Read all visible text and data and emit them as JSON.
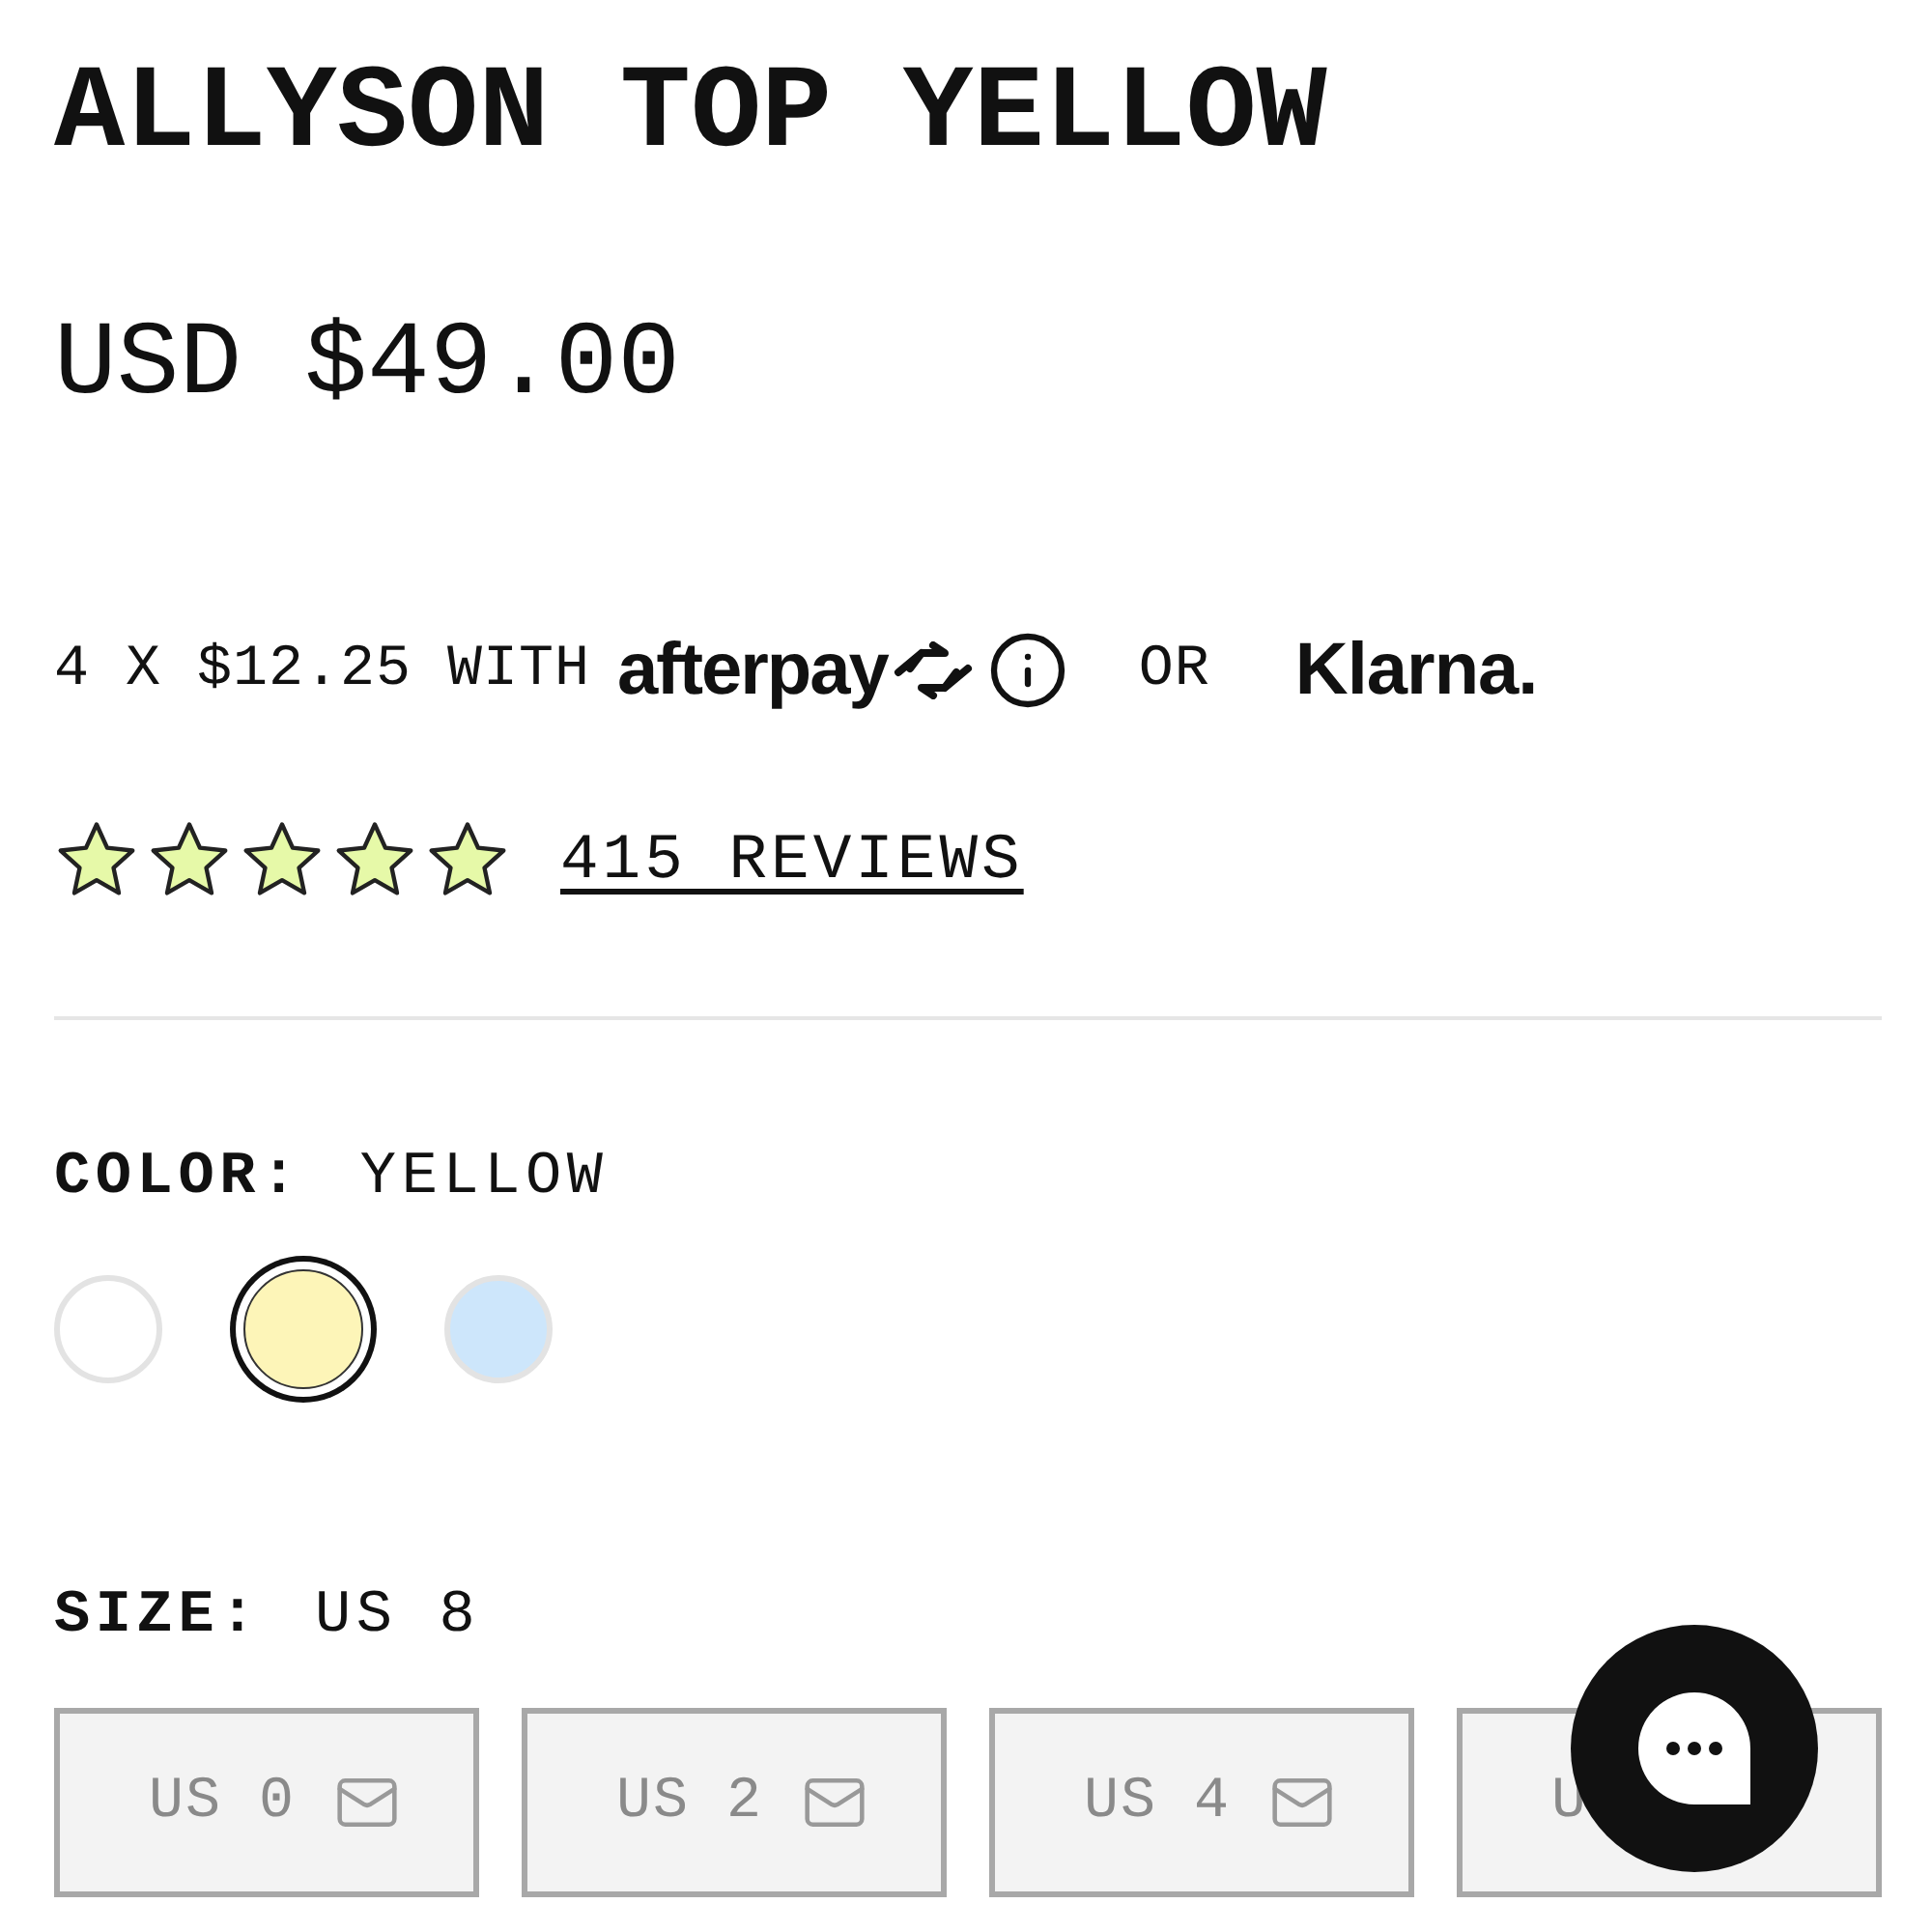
{
  "product": {
    "title": "ALLYSON TOP YELLOW",
    "price": "USD $49.00"
  },
  "installments": {
    "text": "4 X $12.25 WITH",
    "afterpay": "afterpay",
    "or": "OR",
    "klarna": "Klarna."
  },
  "rating": {
    "stars": 5,
    "reviews": "415 REVIEWS"
  },
  "color": {
    "label": "COLOR:",
    "value": "YELLOW"
  },
  "colors": [
    {
      "color": "#ffffff",
      "selected": false
    },
    {
      "color": "#fdf5b8",
      "selected": true
    },
    {
      "color": "#cde6fb",
      "selected": false
    }
  ],
  "size": {
    "label": "SIZE:",
    "value": "US 8"
  },
  "sizes": [
    {
      "label": "US 0",
      "mail_icon": true
    },
    {
      "label": "US 2",
      "mail_icon": true
    },
    {
      "label": "US 4",
      "mail_icon": true
    },
    {
      "label": "U"
    }
  ]
}
